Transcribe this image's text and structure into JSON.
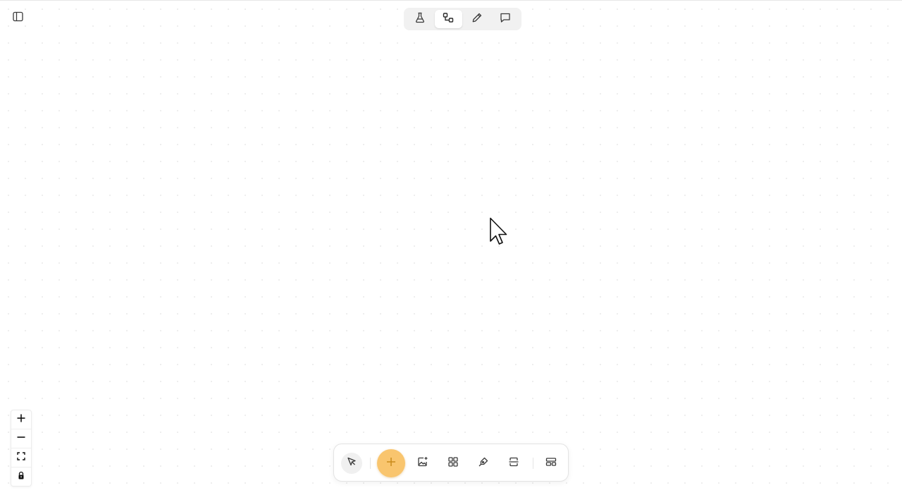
{
  "colors": {
    "accent": "#f9c56e",
    "accent_icon": "#c98a1a",
    "icon": "#3a3a3a",
    "switcher_bg": "#f1f1f1"
  },
  "header": {
    "sidebar_toggle_icon": "sidebar-panel-icon",
    "modes": [
      {
        "icon": "flask-icon",
        "active": false
      },
      {
        "icon": "flow-diagram-icon",
        "active": true
      },
      {
        "icon": "pencil-icon",
        "active": false
      },
      {
        "icon": "comment-icon",
        "active": false
      }
    ]
  },
  "zoom_controls": [
    {
      "icon": "zoom-in-icon",
      "glyph": "+"
    },
    {
      "icon": "zoom-out-icon",
      "glyph": "–"
    },
    {
      "icon": "fit-view-icon"
    },
    {
      "icon": "lock-icon"
    }
  ],
  "toolbar": {
    "tools": [
      {
        "icon": "pointer-select-icon",
        "selected": true
      },
      {
        "icon": "add-icon",
        "glyph": "+"
      },
      {
        "icon": "image-generate-icon"
      },
      {
        "icon": "grid-icon"
      },
      {
        "icon": "pen-draw-icon"
      },
      {
        "icon": "split-section-icon"
      },
      {
        "icon": "layout-icon"
      }
    ]
  }
}
